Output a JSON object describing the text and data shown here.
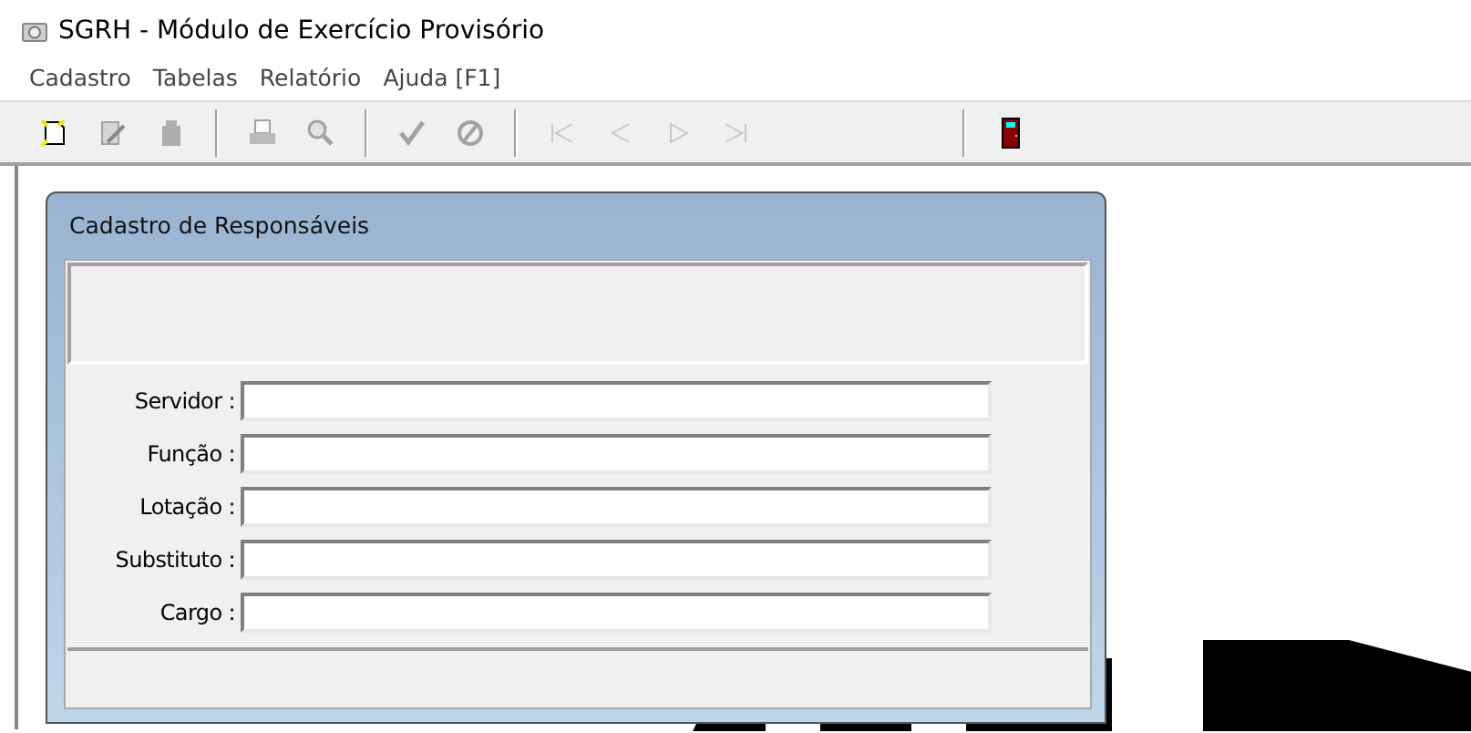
{
  "window": {
    "title": "SGRH - Módulo de Exercício Provisório"
  },
  "menu": [
    {
      "label": "Cadastro"
    },
    {
      "label": "Tabelas"
    },
    {
      "label": "Relatório"
    },
    {
      "label": "Ajuda [F1]"
    }
  ],
  "toolbar": [
    {
      "kind": "new",
      "disabled": false
    },
    {
      "kind": "edit",
      "disabled": true
    },
    {
      "kind": "delete",
      "disabled": true
    },
    {
      "kind": "separator"
    },
    {
      "kind": "print",
      "disabled": true
    },
    {
      "kind": "zoom",
      "disabled": true
    },
    {
      "kind": "separator"
    },
    {
      "kind": "confirm",
      "disabled": true
    },
    {
      "kind": "cancel",
      "disabled": true
    },
    {
      "kind": "separator"
    },
    {
      "kind": "first",
      "disabled": true
    },
    {
      "kind": "prev",
      "disabled": true
    },
    {
      "kind": "next",
      "disabled": true
    },
    {
      "kind": "last",
      "disabled": true
    },
    {
      "kind": "gap"
    },
    {
      "kind": "separator"
    },
    {
      "kind": "exit",
      "disabled": false
    }
  ],
  "dialog": {
    "title": "Cadastro de Responsáveis",
    "fields": [
      {
        "label": "Servidor :"
      },
      {
        "label": "Função :"
      },
      {
        "label": "Lotação :"
      },
      {
        "label": "Substituto :"
      },
      {
        "label": "Cargo :"
      }
    ]
  }
}
